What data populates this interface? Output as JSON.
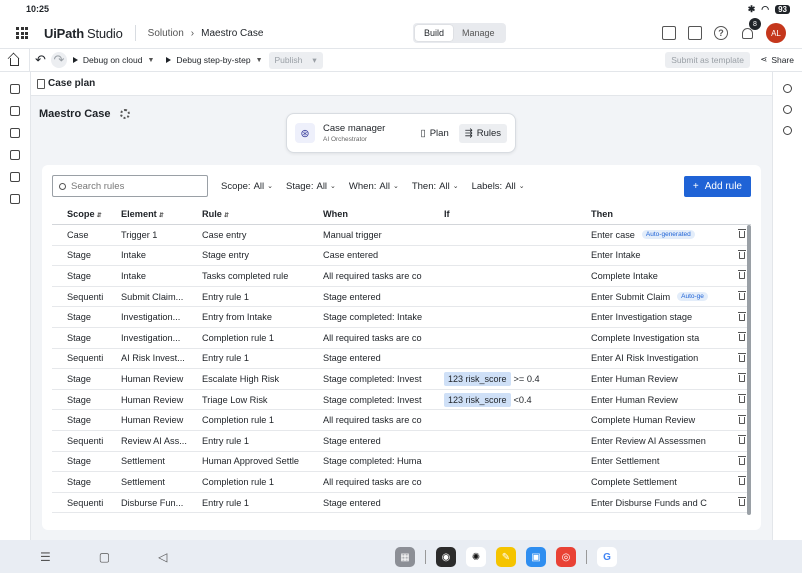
{
  "status": {
    "time": "10:25",
    "battery": "93"
  },
  "app": {
    "logo_brand": "UiPath",
    "logo_product": "Studio",
    "breadcrumb": [
      "Solution",
      "Maestro Case"
    ],
    "modes": [
      "Build",
      "Manage"
    ],
    "active_mode": "Build",
    "notification_count": "8",
    "avatar_initials": "AL"
  },
  "toolbar": {
    "debug_cloud": "Debug on cloud",
    "debug_step": "Debug step-by-step",
    "publish": "Publish",
    "submit_template": "Submit as template",
    "share": "Share"
  },
  "case_tab": "Case plan",
  "page_title": "Maestro Case",
  "card": {
    "title": "Case manager",
    "subtitle": "AI Orchestrator",
    "tab_plan": "Plan",
    "tab_rules": "Rules"
  },
  "filters": {
    "search_placeholder": "Search rules",
    "scope": "Scope:",
    "stage": "Stage:",
    "when": "When:",
    "then": "Then:",
    "labels": "Labels:",
    "all": "All",
    "add_rule": "Add rule"
  },
  "table": {
    "headers": [
      "Scope",
      "Element",
      "Rule",
      "When",
      "If",
      "Then"
    ],
    "rows": [
      [
        "Case",
        "Trigger 1",
        "Case entry",
        "Manual trigger",
        "",
        "Enter case",
        "Auto-generated"
      ],
      [
        "Stage",
        "Intake",
        "Stage entry",
        "Case entered",
        "",
        "Enter Intake",
        ""
      ],
      [
        "Stage",
        "Intake",
        "Tasks completed rule",
        "All required tasks are co",
        "",
        "Complete Intake",
        ""
      ],
      [
        "Sequenti",
        "Submit Claim...",
        "Entry rule 1",
        "Stage entered",
        "",
        "Enter Submit Claim",
        "Auto-ge"
      ],
      [
        "Stage",
        "Investigation...",
        "Entry from Intake",
        "Stage completed: Intake",
        "",
        "Enter Investigation stage",
        ""
      ],
      [
        "Stage",
        "Investigation...",
        "Completion rule 1",
        "All required tasks are co",
        "",
        "Complete Investigation sta",
        ""
      ],
      [
        "Sequenti",
        "AI Risk Invest...",
        "Entry rule 1",
        "Stage entered",
        "",
        "Enter AI Risk Investigation",
        ""
      ],
      [
        "Stage",
        "Human Review",
        "Escalate High Risk",
        "Stage completed: Invest",
        "risk_score|>= 0.4",
        "Enter Human Review",
        ""
      ],
      [
        "Stage",
        "Human Review",
        "Triage Low Risk",
        "Stage completed: Invest",
        "risk_score|<0.4",
        "Enter Human Review",
        ""
      ],
      [
        "Stage",
        "Human Review",
        "Completion rule 1",
        "All required tasks are co",
        "",
        "Complete Human Review",
        ""
      ],
      [
        "Sequenti",
        "Review AI Ass...",
        "Entry rule 1",
        "Stage entered",
        "",
        "Enter Review AI Assessmen",
        ""
      ],
      [
        "Stage",
        "Settlement",
        "Human Approved Settle",
        "Stage completed: Huma",
        "",
        "Enter Settlement",
        ""
      ],
      [
        "Stage",
        "Settlement",
        "Completion rule 1",
        "All required tasks are co",
        "",
        "Complete Settlement",
        ""
      ],
      [
        "Sequenti",
        "Disburse Fun...",
        "Entry rule 1",
        "Stage entered",
        "",
        "Enter Disburse Funds and C",
        ""
      ]
    ]
  },
  "accent": "#1f63d6"
}
